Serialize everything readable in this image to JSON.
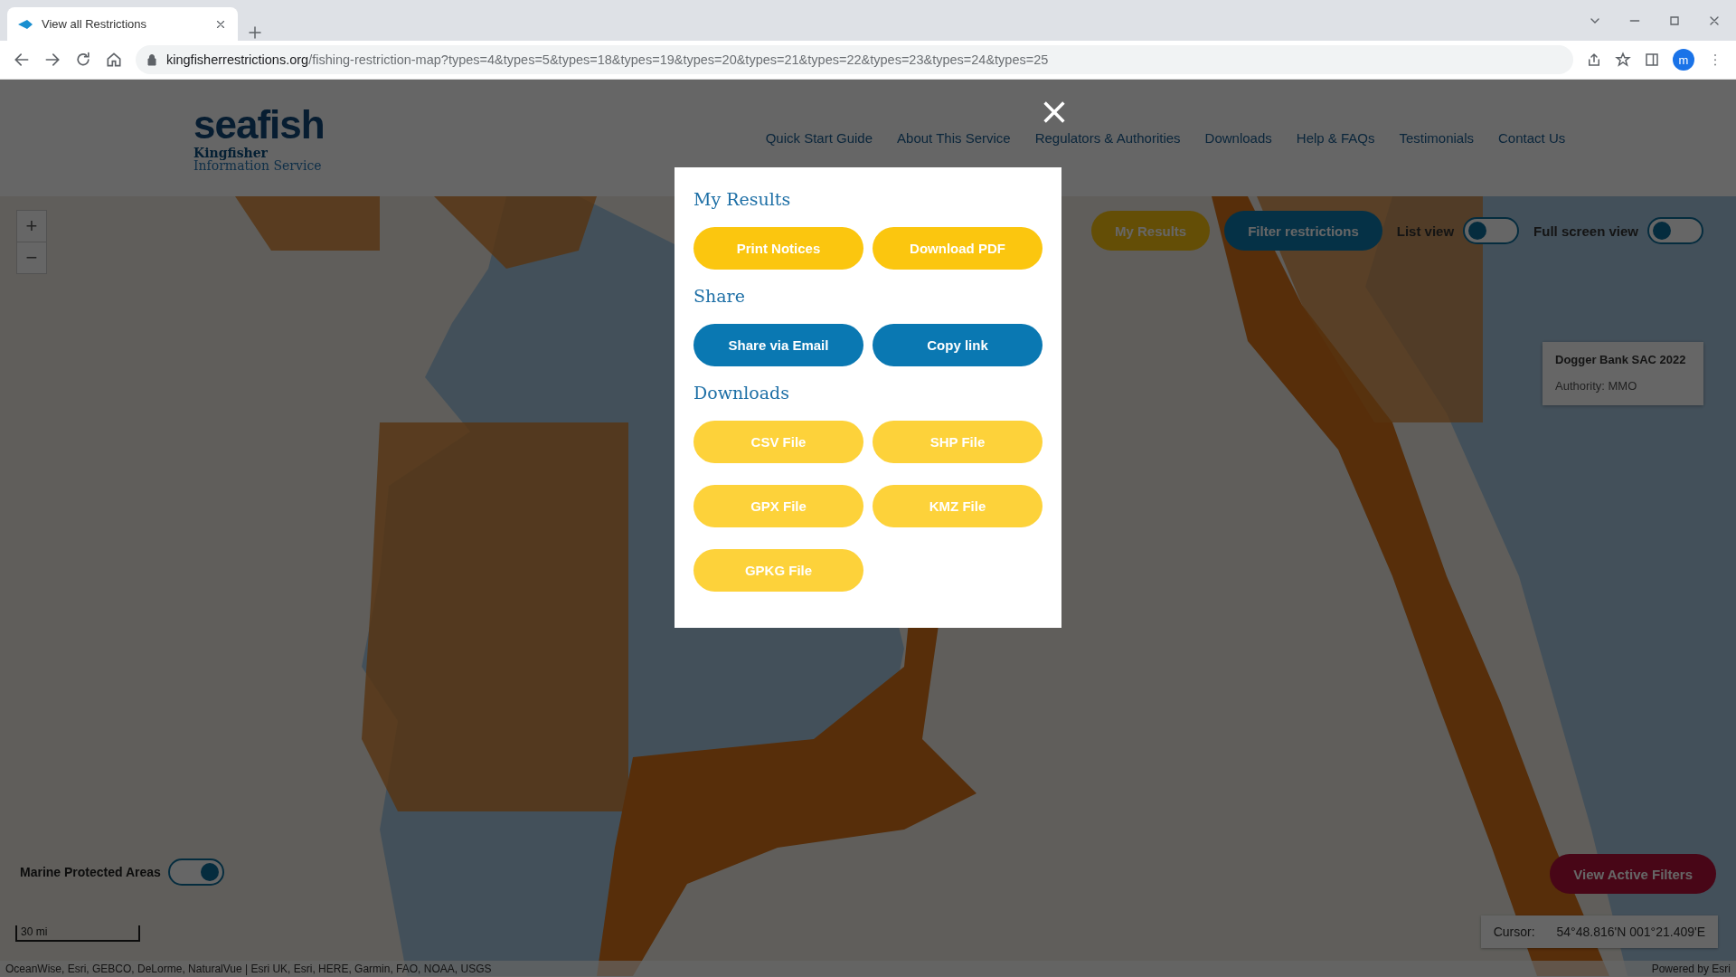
{
  "browser": {
    "tab_title": "View all Restrictions",
    "url_host": "kingfisherrestrictions.org",
    "url_path": "/fishing-restriction-map?types=4&types=5&types=18&types=19&types=20&types=21&types=22&types=23&types=24&types=25",
    "profile_initial": "m"
  },
  "header": {
    "logo": {
      "wordmark": "seafish",
      "line1": "Kingfisher",
      "line2": "Information Service"
    },
    "nav": [
      "Quick Start Guide",
      "About This Service",
      "Regulators & Authorities",
      "Downloads",
      "Help & FAQs",
      "Testimonials",
      "Contact Us"
    ]
  },
  "map": {
    "zoom": [
      "+",
      "−"
    ],
    "buttons": [
      {
        "label": "My Results",
        "kind": "yellow"
      },
      {
        "label": "Filter restrictions",
        "kind": "blue"
      }
    ],
    "toggles": [
      {
        "label": "List view",
        "on": false
      },
      {
        "label": "Full screen view",
        "on": false
      }
    ],
    "popup": {
      "title": "Dogger Bank SAC 2022",
      "authority": "Authority: MMO"
    },
    "layer_toggle": {
      "label": "Marine Protected Areas",
      "on": true
    },
    "scale": "30 mi",
    "attribution": "OceanWise, Esri, GEBCO, DeLorme, NaturalVue | Esri UK, Esri, HERE, Garmin, FAO, NOAA, USGS",
    "powered_by": "Powered by Esri",
    "active_filters_button": "View Active Filters",
    "cursor": {
      "label": "Cursor:",
      "value": "54°48.816'N 001°21.409'E"
    }
  },
  "modal": {
    "sections": [
      {
        "heading": "My Results",
        "buttons": [
          {
            "label": "Print Notices",
            "kind": "yellow"
          },
          {
            "label": "Download PDF",
            "kind": "yellow"
          }
        ]
      },
      {
        "heading": "Share",
        "buttons": [
          {
            "label": "Share via Email",
            "kind": "blue"
          },
          {
            "label": "Copy link",
            "kind": "blue"
          }
        ]
      },
      {
        "heading": "Downloads",
        "buttons": [
          {
            "label": "CSV File",
            "kind": "pale"
          },
          {
            "label": "SHP File",
            "kind": "pale"
          },
          {
            "label": "GPX File",
            "kind": "pale"
          },
          {
            "label": "KMZ File",
            "kind": "pale"
          },
          {
            "label": "GPKG File",
            "kind": "pale"
          }
        ]
      }
    ]
  }
}
